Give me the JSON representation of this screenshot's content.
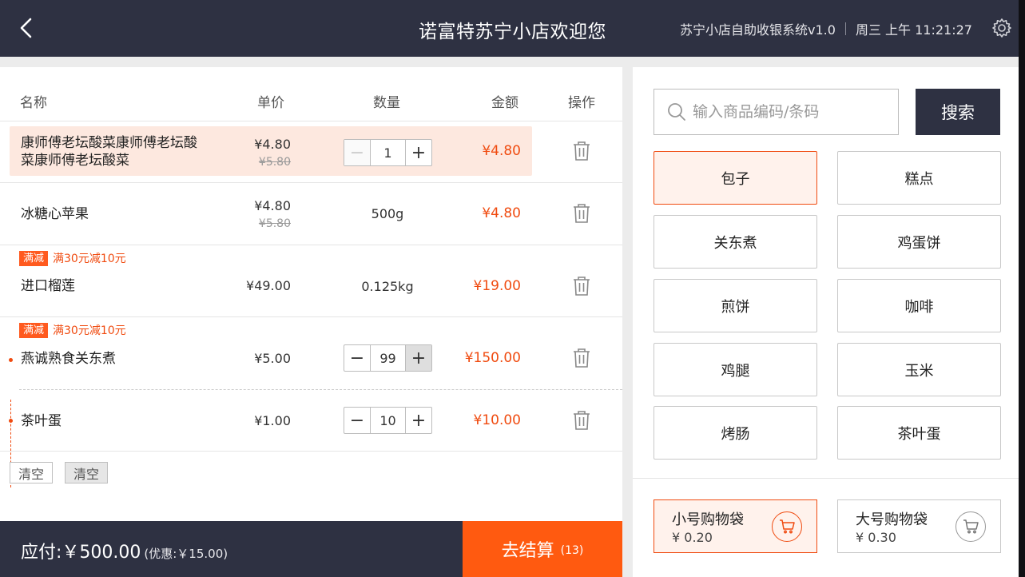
{
  "header": {
    "title": "诺富特苏宁小店欢迎您",
    "system_name": "苏宁小店自助收银系统v1.0",
    "datetime": "周三 上午 11:21:27"
  },
  "table": {
    "columns": [
      "名称",
      "单价",
      "数量",
      "金额",
      "操作"
    ]
  },
  "items": [
    {
      "name_line1": "康师傅老坛酸菜康师傅老坛酸",
      "name_line2": "菜康师傅老坛酸菜",
      "price": "¥4.80",
      "old_price": "¥5.80",
      "qty": "1",
      "amount": "¥4.80"
    },
    {
      "name": "冰糖心苹果",
      "price": "¥4.80",
      "old_price": "¥5.80",
      "qty": "500g",
      "amount": "¥4.80"
    },
    {
      "promo_tag": "满减",
      "promo_text": "满30元减10元",
      "name": "进口榴莲",
      "price": "¥49.00",
      "qty": "0.125kg",
      "amount": "¥19.00"
    },
    {
      "promo_tag": "满减",
      "promo_text": "满30元减10元",
      "name": "燕诚熟食关东煮",
      "price": "¥5.00",
      "qty": "99",
      "amount": "¥150.00"
    },
    {
      "name": "茶叶蛋",
      "price": "¥1.00",
      "qty": "10",
      "amount": "¥10.00"
    }
  ],
  "clear_buttons": [
    "清空",
    "清空"
  ],
  "footer": {
    "payable": "应付:￥500.00",
    "discount": "(优惠:￥15.00)",
    "checkout_label": "去结算",
    "checkout_count": "(13)"
  },
  "search": {
    "placeholder": "输入商品编码/条码",
    "button": "搜索"
  },
  "categories": [
    "包子",
    "糕点",
    "关东煮",
    "鸡蛋饼",
    "煎饼",
    "咖啡",
    "鸡腿",
    "玉米",
    "烤肠",
    "茶叶蛋"
  ],
  "selected_category": "包子",
  "bags": [
    {
      "name": "小号购物袋",
      "price": "¥ 0.20",
      "selected": true
    },
    {
      "name": "大号购物袋",
      "price": "¥ 0.30",
      "selected": false
    }
  ],
  "colors": {
    "accent": "#ff5a10",
    "dark": "#2e3142",
    "highlight": "#fde8df"
  }
}
